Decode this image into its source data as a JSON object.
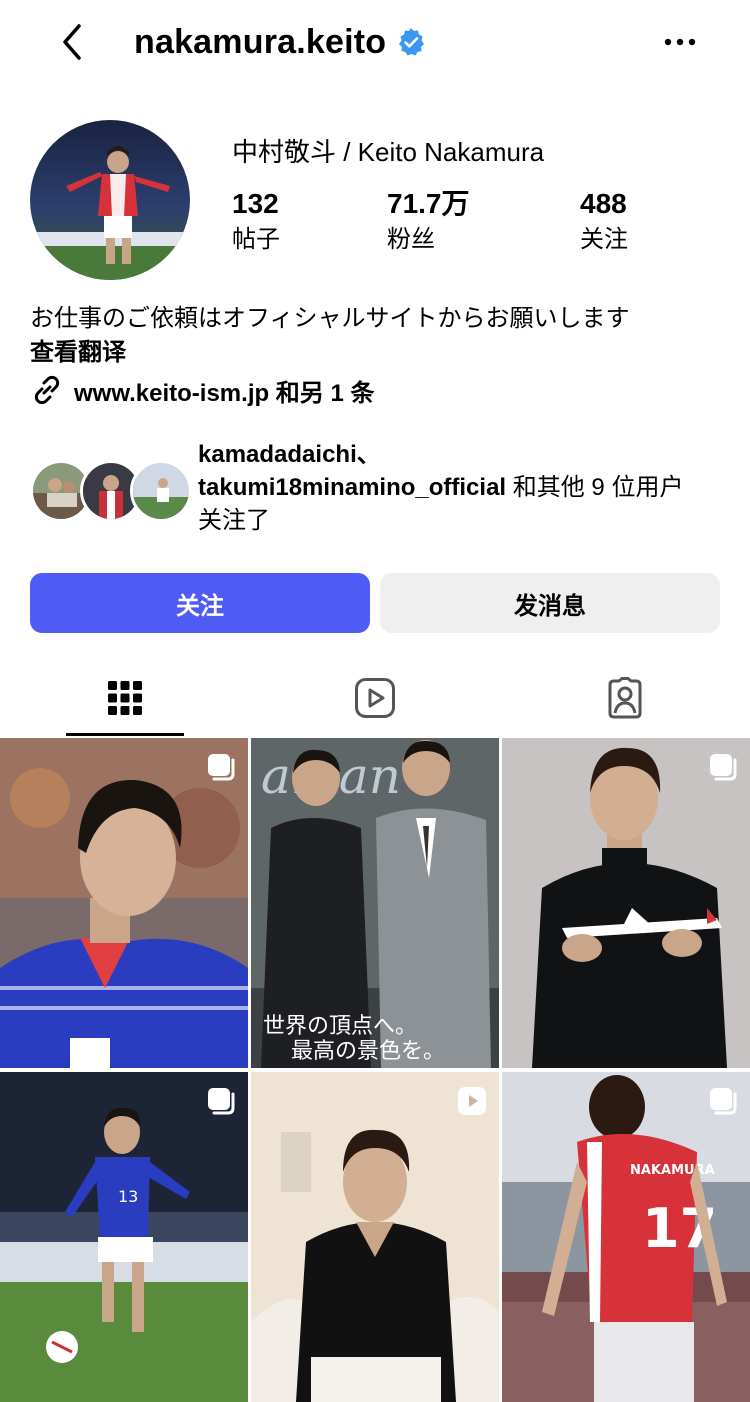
{
  "header": {
    "username": "nakamura.keito",
    "back_icon": "chevron-left-icon",
    "verified_icon": "verified-badge-icon",
    "more_icon": "more-horizontal-icon"
  },
  "profile": {
    "full_name": "中村敬斗 / Keito Nakamura",
    "stats": [
      {
        "value": "132",
        "label": "帖子"
      },
      {
        "value": "71.7万",
        "label": "粉丝"
      },
      {
        "value": "488",
        "label": "关注"
      }
    ],
    "bio": "お仕事のご依頼はオフィシャルサイトからお願いします",
    "translate_label": "查看翻译",
    "link_text": "www.keito-ism.jp 和另 1 条",
    "link_icon": "link-icon"
  },
  "followed_by": {
    "line1": "kamadadaichi、",
    "line2_bold": "takumi18minamino_official",
    "line2_rest": " 和其他 9 位用户",
    "line3": "关注了"
  },
  "actions": {
    "follow_label": "关注",
    "message_label": "发消息"
  },
  "tabs": [
    {
      "name": "grid",
      "icon": "grid-icon",
      "active": true
    },
    {
      "name": "reels",
      "icon": "reels-icon",
      "active": false
    },
    {
      "name": "tagged",
      "icon": "tagged-person-icon",
      "active": false
    }
  ],
  "posts": [
    {
      "type": "carousel",
      "badge_icon": "multiple-photos-icon"
    },
    {
      "type": "image"
    },
    {
      "type": "carousel",
      "badge_icon": "multiple-photos-icon"
    },
    {
      "type": "carousel",
      "badge_icon": "multiple-photos-icon"
    },
    {
      "type": "video",
      "badge_icon": "reel-play-icon"
    },
    {
      "type": "carousel",
      "badge_icon": "multiple-photos-icon"
    }
  ],
  "colors": {
    "accent": "#4f5bf4",
    "verified": "#3897f0",
    "secondary_button": "#efefef"
  }
}
